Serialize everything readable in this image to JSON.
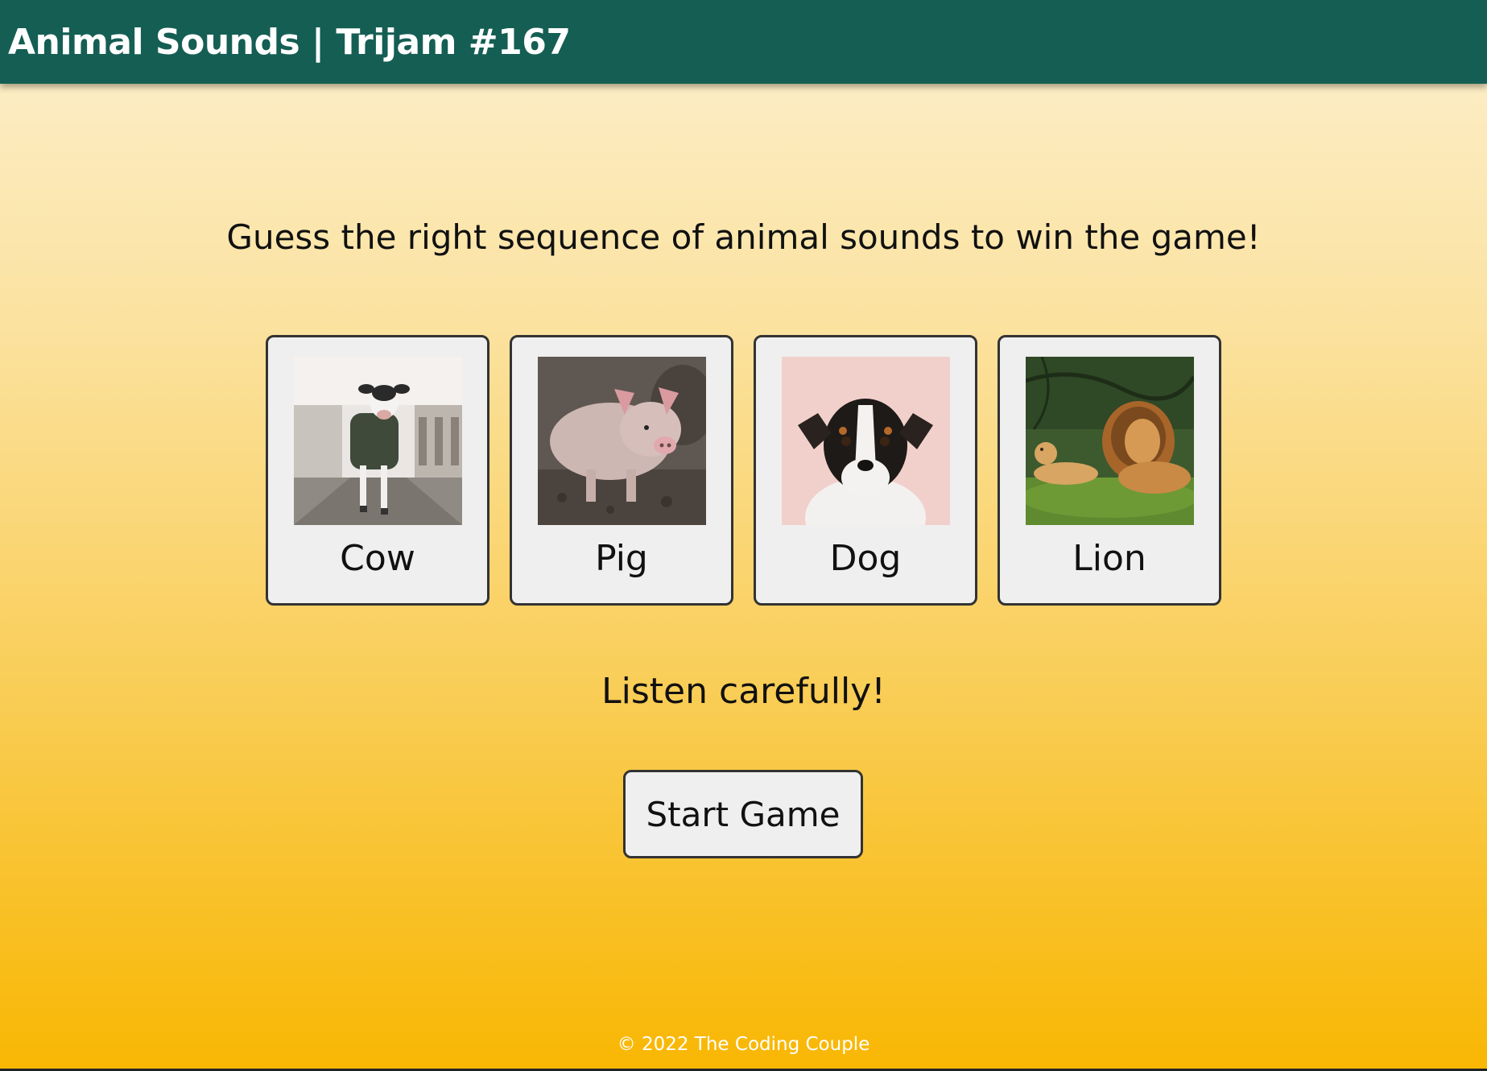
{
  "header": {
    "title": "Animal Sounds | Trijam #167"
  },
  "instruction": "Guess the right sequence of animal sounds to win the game!",
  "cards": [
    {
      "label": "Cow",
      "icon": "cow-photo"
    },
    {
      "label": "Pig",
      "icon": "pig-photo"
    },
    {
      "label": "Dog",
      "icon": "dog-photo"
    },
    {
      "label": "Lion",
      "icon": "lion-photo"
    }
  ],
  "status": "Listen carefully!",
  "start_button": {
    "label": "Start Game"
  },
  "footer": {
    "text": "© 2022 The Coding Couple"
  },
  "colors": {
    "header_bg": "#155e53",
    "card_bg": "#efefef",
    "gradient_top": "#fcf0cf",
    "gradient_bottom": "#f9b703"
  }
}
